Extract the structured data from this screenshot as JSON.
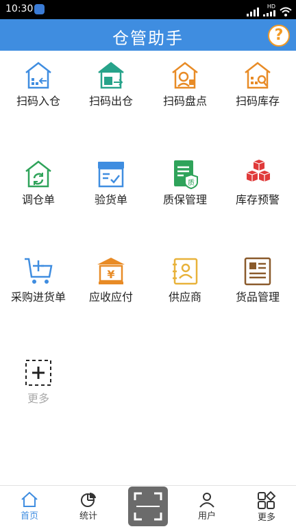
{
  "status": {
    "time": "10:30",
    "hd": "HD"
  },
  "header": {
    "title": "仓管助手",
    "help": "?"
  },
  "tiles": [
    {
      "label": "扫码入仓",
      "icon": "warehouse-in-icon",
      "color": "#3f8de0"
    },
    {
      "label": "扫码出仓",
      "icon": "warehouse-out-icon",
      "color": "#27a38a"
    },
    {
      "label": "扫码盘点",
      "icon": "warehouse-check-icon",
      "color": "#e88b26"
    },
    {
      "label": "扫码库存",
      "icon": "warehouse-stock-icon",
      "color": "#e88b26"
    },
    {
      "label": "调仓单",
      "icon": "transfer-icon",
      "color": "#2fa35a"
    },
    {
      "label": "验货单",
      "icon": "inspect-icon",
      "color": "#3f8de0"
    },
    {
      "label": "质保管理",
      "icon": "warranty-icon",
      "color": "#2fa35a",
      "badge": "质"
    },
    {
      "label": "库存预警",
      "icon": "stock-alert-icon",
      "color": "#e03a3a"
    },
    {
      "label": "采购进货单",
      "icon": "purchase-cart-icon",
      "color": "#3f8de0"
    },
    {
      "label": "应收应付",
      "icon": "receivable-icon",
      "color": "#e88b26",
      "symbol": "¥"
    },
    {
      "label": "供应商",
      "icon": "supplier-icon",
      "color": "#e8b23a"
    },
    {
      "label": "货品管理",
      "icon": "goods-icon",
      "color": "#8a5a2b"
    },
    {
      "label": "更多",
      "icon": "add-more-icon",
      "color": "#222"
    }
  ],
  "tabbar": {
    "items": [
      {
        "label": "首页",
        "icon": "home-icon",
        "active": true
      },
      {
        "label": "统计",
        "icon": "pie-chart-icon"
      },
      {
        "label": "用户",
        "icon": "user-icon"
      },
      {
        "label": "更多",
        "icon": "apps-icon"
      }
    ],
    "scan_icon": "scan-icon"
  }
}
